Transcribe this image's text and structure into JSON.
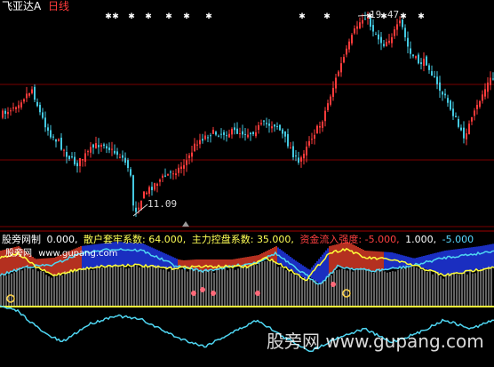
{
  "title": {
    "stock_name": "飞亚达A",
    "period": "日线",
    "name_color": "#ffffff",
    "period_color": "#ff3b3b"
  },
  "price_panel": {
    "high_marker": "19.47",
    "low_marker": "11.09",
    "marker_color": "#d8d8d8",
    "up_color": "#ff3b3b",
    "down_color": "#44c8e0",
    "signal_glyph": "✱",
    "signal_color": "#ffffff"
  },
  "indicator_panel": {
    "legend": {
      "name": "股旁网制",
      "v0": "0.000,",
      "label1": "散户套牢系数:",
      "value1": "64.000,",
      "label2": "主力控盘系数:",
      "value2": "35.000,",
      "label3": "资金流入强度:",
      "value3": "-5.000,",
      "value4": "1.000,",
      "value5": "-5.000"
    },
    "sub_label": "股旁网",
    "sub_url": "www.gupang.com",
    "colors": {
      "name": "#ffffff",
      "v0": "#ffffff",
      "label1": "#ffff55",
      "label2": "#ffff55",
      "label3": "#ff4040",
      "value4": "#ffffff",
      "value5": "#5ad8ff",
      "sub_label": "#ffffff",
      "sub_url": "#ffffff"
    },
    "line_colors": {
      "cyan": "#4fd6f2",
      "yellow": "#ffff3a",
      "blue_fill": "#1a2ec0",
      "red_fill": "#b43020",
      "white_bars": "#e8e8e8",
      "pink": "#ff6a7a"
    }
  },
  "watermark": "股旁网 www.gupang.com"
}
